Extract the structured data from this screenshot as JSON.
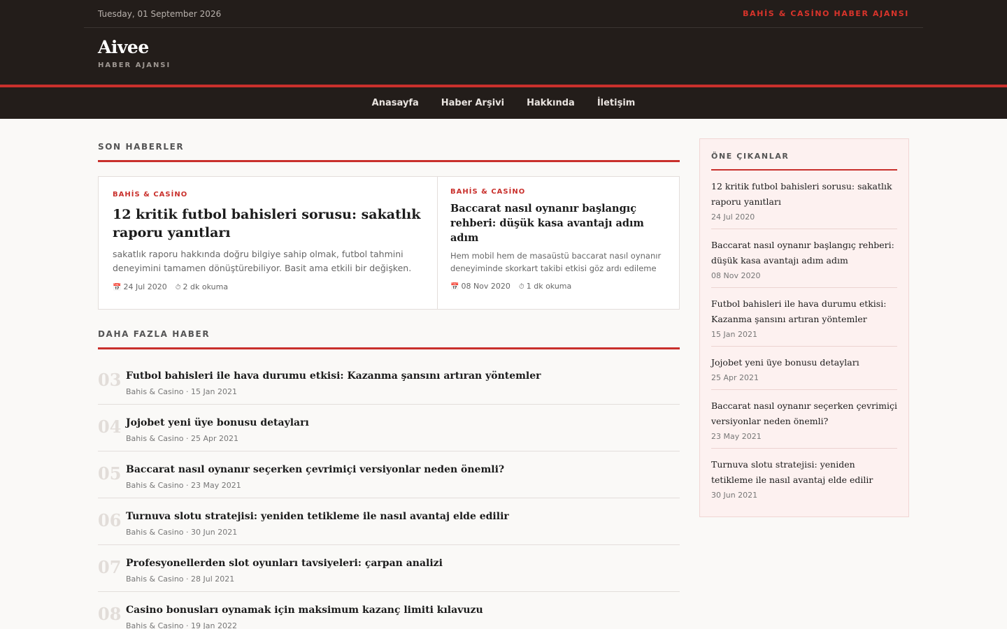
{
  "topbar": {
    "date": "Tuesday, 01 September 2026",
    "tagline": "BAHİS & CASİNO HABER AJANSI"
  },
  "brand": {
    "logo": "Aivee",
    "subtitle": "HABER AJANSI"
  },
  "nav": [
    "Anasayfa",
    "Haber Arşivi",
    "Hakkında",
    "İletişim"
  ],
  "latest": {
    "title": "SON HABERLER",
    "featured": [
      {
        "category": "BAHİS & CASİNO",
        "title": "12 kritik futbol bahisleri sorusu: sakatlık raporu yanıtları",
        "excerpt": "sakatlık raporu hakkında doğru bilgiye sahip olmak, futbol tahmini deneyimini tamamen dönüştürebiliyor. Basit ama etkili bir değişken.",
        "date": "24 Jul 2020",
        "read": "2 dk okuma"
      },
      {
        "category": "BAHİS & CASİNO",
        "title": "Baccarat nasıl oynanır başlangıç rehberi: düşük kasa avantajı adım adım",
        "excerpt": "Hem mobil hem de masaüstü baccarat nasıl oynanır deneyiminde skorkart takibi etkisi göz ardı edileme",
        "date": "08 Nov 2020",
        "read": "1 dk okuma"
      }
    ]
  },
  "more": {
    "title": "DAHA FAZLA HABER",
    "items": [
      {
        "num": "03",
        "title": "Futbol bahisleri ile hava durumu etkisi: Kazanma şansını artıran yöntemler",
        "meta": "Bahis & Casino · 15 Jan 2021"
      },
      {
        "num": "04",
        "title": "Jojobet yeni üye bonusu detayları",
        "meta": "Bahis & Casino · 25 Apr 2021"
      },
      {
        "num": "05",
        "title": "Baccarat nasıl oynanır seçerken çevrimiçi versiyonlar neden önemli?",
        "meta": "Bahis & Casino · 23 May 2021"
      },
      {
        "num": "06",
        "title": "Turnuva slotu stratejisi: yeniden tetikleme ile nasıl avantaj elde edilir",
        "meta": "Bahis & Casino · 30 Jun 2021"
      },
      {
        "num": "07",
        "title": "Profesyonellerden slot oyunları tavsiyeleri: çarpan analizi",
        "meta": "Bahis & Casino · 28 Jul 2021"
      },
      {
        "num": "08",
        "title": "Casino bonusları oynamak için maksimum kazanç limiti kılavuzu",
        "meta": "Bahis & Casino · 19 Jan 2022"
      }
    ]
  },
  "sidebar": {
    "title": "ÖNE ÇIKANLAR",
    "items": [
      {
        "title": "12 kritik futbol bahisleri sorusu: sakatlık raporu yanıtları",
        "date": "24 Jul 2020"
      },
      {
        "title": "Baccarat nasıl oynanır başlangıç rehberi: düşük kasa avantajı adım adım",
        "date": "08 Nov 2020"
      },
      {
        "title": "Futbol bahisleri ile hava durumu etkisi: Kazanma şansını artıran yöntemler",
        "date": "15 Jan 2021"
      },
      {
        "title": "Jojobet yeni üye bonusu detayları",
        "date": "25 Apr 2021"
      },
      {
        "title": "Baccarat nasıl oynanır seçerken çevrimiçi versiyonlar neden önemli?",
        "date": "23 May 2021"
      },
      {
        "title": "Turnuva slotu stratejisi: yeniden tetikleme ile nasıl avantaj elde edilir",
        "date": "30 Jun 2021"
      }
    ]
  }
}
